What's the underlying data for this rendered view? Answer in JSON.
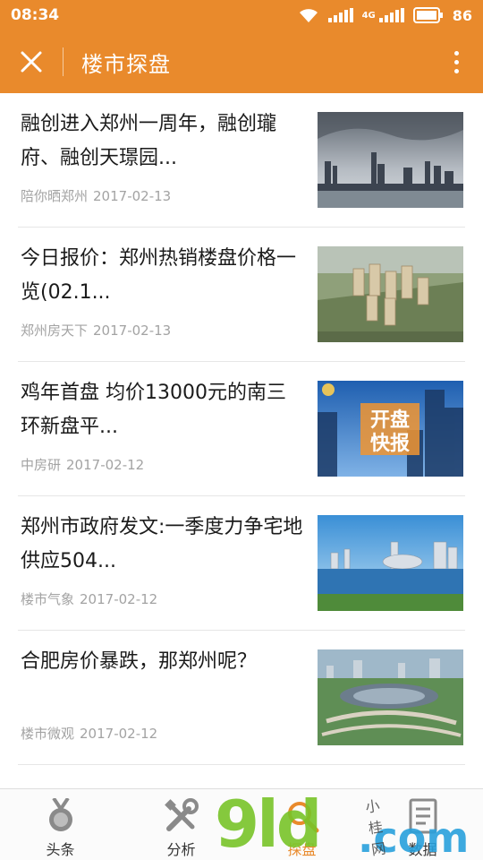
{
  "status_bar": {
    "time": "08:34",
    "network": "4G",
    "battery": "86"
  },
  "app_bar": {
    "title": "楼市探盘"
  },
  "articles": [
    {
      "title": "融创进入郑州一周年，融创瓏府、融创天璟园...",
      "source": "陪你晒郑州",
      "date": "2017-02-13",
      "thumb": "skyline"
    },
    {
      "title": "今日报价：郑州热销楼盘价格一览(02.1...",
      "source": "郑州房天下",
      "date": "2017-02-13",
      "thumb": "aerial-render"
    },
    {
      "title": "鸡年首盘 均价13000元的南三环新盘平...",
      "source": "中房研",
      "date": "2017-02-12",
      "thumb": "opening-poster",
      "thumb_text": [
        "开盘",
        "快报"
      ]
    },
    {
      "title": "郑州市政府发文:一季度力争宅地供应504...",
      "source": "楼市气象",
      "date": "2017-02-12",
      "thumb": "lake-city"
    },
    {
      "title": "合肥房价暴跌，那郑州呢？",
      "source": "楼市微观",
      "date": "2017-02-12",
      "thumb": "stadium"
    }
  ],
  "tabs": [
    {
      "label": "头条",
      "icon": "medal-icon"
    },
    {
      "label": "分析",
      "icon": "tools-icon"
    },
    {
      "label": "探盘",
      "icon": "search-icon"
    },
    {
      "label": "数据",
      "icon": "document-icon"
    }
  ],
  "watermark": {
    "brand": "9ld",
    "domain": ".com",
    "tag": "小桂网商店"
  },
  "colors": {
    "accent": "#e98a2c",
    "meta_text": "#a3a3a3",
    "title_text": "#1b1b1b"
  }
}
